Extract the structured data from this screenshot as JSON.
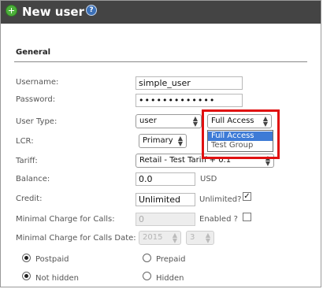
{
  "header": {
    "title": "New user",
    "icon_left": "plus-icon",
    "icon_right": "help-icon",
    "help_glyph": "?"
  },
  "section": {
    "title": "General"
  },
  "fields": {
    "username": {
      "label": "Username:",
      "value": "simple_user"
    },
    "password": {
      "label": "Password:",
      "value": "•••••••••••••"
    },
    "user_type": {
      "label": "User Type:",
      "value": "user"
    },
    "access": {
      "value": "Full Access",
      "options": [
        "Full Access",
        "Test Group"
      ]
    },
    "lcr": {
      "label": "LCR:",
      "value": "Primary"
    },
    "tariff": {
      "label": "Tariff:",
      "value": "Retail - Test Tariff + 0.1"
    },
    "balance": {
      "label": "Balance:",
      "value": "0.0",
      "unit": "USD"
    },
    "credit": {
      "label": "Credit:",
      "value": "Unlimited",
      "unlimited_label": "Unlimited?",
      "unlimited_checked": true
    },
    "min_charge": {
      "label": "Minimal Charge for Calls:",
      "value": "0",
      "enabled_label": "Enabled ?",
      "enabled_checked": false
    },
    "min_charge_date": {
      "label": "Minimal Charge for Calls Date:",
      "year": "2015",
      "month": "3"
    }
  },
  "radios": {
    "postpaid": {
      "label": "Postpaid",
      "checked": true
    },
    "prepaid": {
      "label": "Prepaid",
      "checked": false
    },
    "not_hidden": {
      "label": "Not hidden",
      "checked": true
    },
    "hidden": {
      "label": "Hidden",
      "checked": false
    }
  },
  "colors": {
    "titlebar": "#444444",
    "highlight": "#3e7bd6",
    "callout": "#e01010"
  }
}
